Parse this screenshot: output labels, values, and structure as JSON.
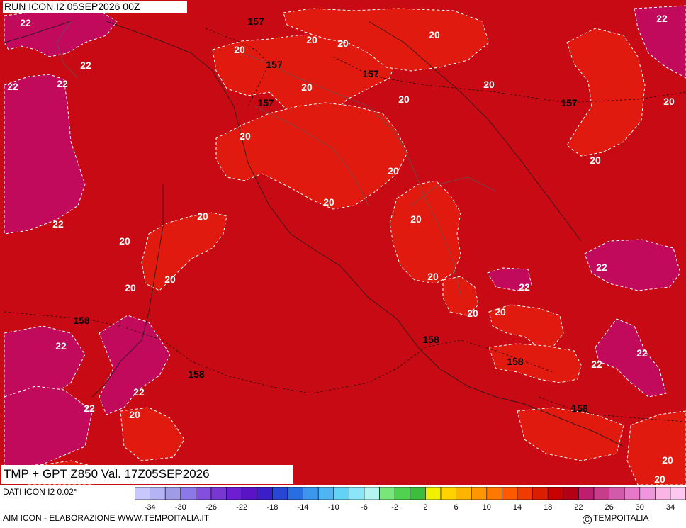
{
  "header": {
    "run": "RUN ICON I2 05SEP2026 00Z",
    "title": "TMP + GPT Z850 Val. 17Z05SEP2026"
  },
  "map": {
    "temperature_labels": [
      "22",
      "22",
      "22",
      "22",
      "22",
      "22",
      "22",
      "22",
      "22",
      "22",
      "22",
      "22",
      "22",
      "20",
      "20",
      "20",
      "20",
      "20",
      "20",
      "20",
      "20",
      "20",
      "20",
      "20",
      "20",
      "20",
      "20",
      "20",
      "20",
      "20",
      "20",
      "20",
      "20",
      "20",
      "20",
      "20",
      "20"
    ],
    "geopotential_labels": [
      "157",
      "157",
      "157",
      "157",
      "157",
      "158",
      "158",
      "158",
      "158",
      "158"
    ]
  },
  "footer": {
    "dati": "DATI ICON I2 0.02°",
    "source": "AIM ICON - ELABORAZIONE WWW.TEMPOITALIA.IT",
    "copyright": "TEMPOITALIA"
  },
  "scale": {
    "tick_labels": [
      "-34",
      "-30",
      "-26",
      "-22",
      "-18",
      "-14",
      "-10",
      "-6",
      "-2",
      "2",
      "6",
      "10",
      "14",
      "18",
      "22",
      "26",
      "30",
      "34"
    ],
    "colors": [
      "#c8c8ff",
      "#b4b4f5",
      "#a09be6",
      "#8c78e6",
      "#8250dc",
      "#7837d2",
      "#6e1ed2",
      "#5a14c8",
      "#3c1ec8",
      "#2846d2",
      "#286ee1",
      "#3c96eb",
      "#50b4f0",
      "#64d2f5",
      "#8ce6fa",
      "#b4f5f0",
      "#78e678",
      "#50d250",
      "#3cbe3c",
      "#f0f000",
      "#ffd200",
      "#ffb400",
      "#ff9600",
      "#ff7800",
      "#ff5a00",
      "#f03c00",
      "#dc1e00",
      "#c80000",
      "#b40014",
      "#be1e6e",
      "#c83c8c",
      "#d25aaa",
      "#e678c8",
      "#f096dc",
      "#fab4e6",
      "#ffc8f0"
    ]
  }
}
